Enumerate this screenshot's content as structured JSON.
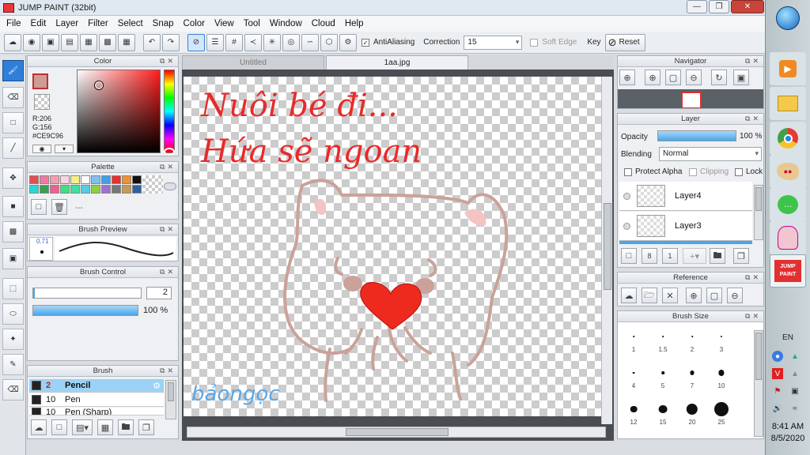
{
  "window": {
    "title": "JUMP PAINT (32bit)"
  },
  "menu": [
    "File",
    "Edit",
    "Layer",
    "Filter",
    "Select",
    "Snap",
    "Color",
    "View",
    "Tool",
    "Window",
    "Cloud",
    "Help"
  ],
  "toolbar": {
    "antialiasing_label": "AntiAliasing",
    "correction_label": "Correction",
    "correction_value": "15",
    "soft_edge_label": "Soft Edge",
    "key_label": "Key",
    "reset_label": "Reset"
  },
  "color_panel": {
    "title": "Color",
    "r": "R:206",
    "g": "G:156",
    "hex": "#CE9C96",
    "current_color": "#ce9c96",
    "accent": "#e05050"
  },
  "palette_panel": {
    "title": "Palette",
    "placeholder": "---",
    "swatches": [
      "#e05050",
      "#f07aa0",
      "#f4a0b4",
      "#f6d6de",
      "#f3f08a",
      "#ffffff",
      "#7fc0f0",
      "#3fa0e8",
      "#e83030",
      "#f09030",
      "#111111",
      "#2ad6d6",
      "#3aa050",
      "#f06090",
      "#40e080",
      "#40e0a0",
      "#50d0e0",
      "#8fd040",
      "#a070d0",
      "#777777",
      "#c89a50",
      "#2f5fa0"
    ]
  },
  "brush_preview": {
    "title": "Brush Preview",
    "size_label": "0.71"
  },
  "brush_control": {
    "title": "Brush Control",
    "size_value": "2",
    "opacity_value": "100 %",
    "opacity_fraction": 1.0
  },
  "brush_panel": {
    "title": "Brush",
    "items": [
      {
        "num": "2",
        "name": "Pencil"
      },
      {
        "num": "10",
        "name": "Pen"
      },
      {
        "num": "10",
        "name": "Pen (Sharp)"
      }
    ]
  },
  "tabs": [
    {
      "label": "Untitled"
    },
    {
      "label": "1aa.jpg"
    }
  ],
  "canvas": {
    "line1": "Nuôi bé đi...",
    "line2": "Hứa sẽ ngoan",
    "signature": "bảongọc"
  },
  "navigator": {
    "title": "Navigator"
  },
  "layer_panel": {
    "title": "Layer",
    "opacity_label": "Opacity",
    "opacity_value": "100 %",
    "opacity_fraction": 1.0,
    "blending_label": "Blending",
    "blending_value": "Normal",
    "protect_alpha_label": "Protect Alpha",
    "clipping_label": "Clipping",
    "lock_label": "Lock",
    "layers": [
      {
        "name": "Layer4"
      },
      {
        "name": "Layer3"
      }
    ]
  },
  "reference_panel": {
    "title": "Reference"
  },
  "brush_size_panel": {
    "title": "Brush Size",
    "sizes": [
      {
        "label": "1",
        "value": 1
      },
      {
        "label": "1.5",
        "value": 1.5
      },
      {
        "label": "2",
        "value": 2
      },
      {
        "label": "3",
        "value": 3
      },
      {
        "label": "4",
        "value": 4
      },
      {
        "label": "5",
        "value": 5
      },
      {
        "label": "7",
        "value": 7
      },
      {
        "label": "10",
        "value": 10
      },
      {
        "label": "12",
        "value": 12
      },
      {
        "label": "15",
        "value": 15
      },
      {
        "label": "20",
        "value": 20
      },
      {
        "label": "25",
        "value": 25
      }
    ]
  },
  "taskbar": {
    "language": "EN",
    "time": "8:41 AM",
    "date": "8/5/2020"
  }
}
